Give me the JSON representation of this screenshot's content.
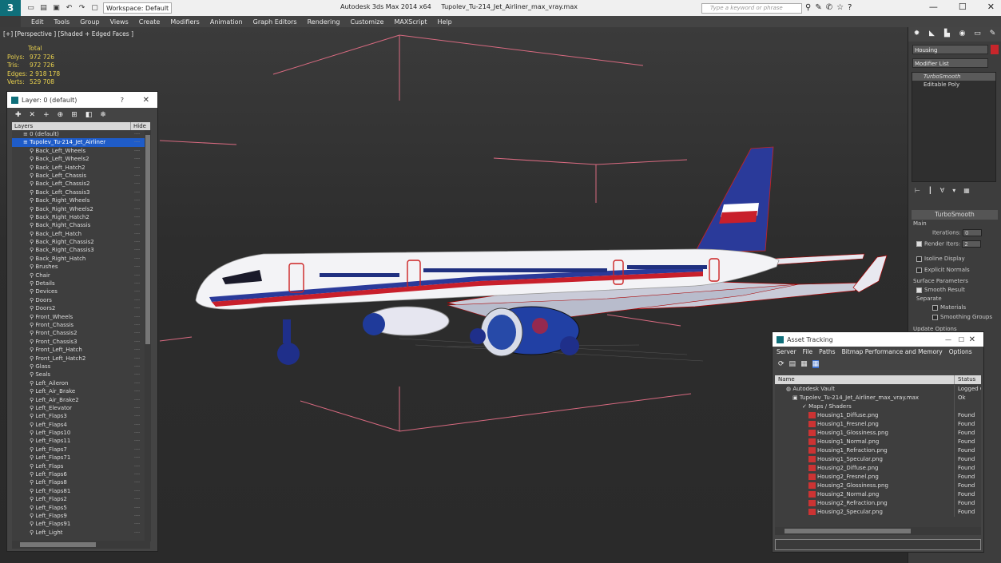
{
  "titlebar": {
    "logo": "3",
    "workspace": "Workspace: Default",
    "app": "Autodesk 3ds Max 2014 x64",
    "file": "Tupolev_Tu-214_Jet_Airliner_max_vray.max",
    "search_placeholder": "Type a keyword or phrase"
  },
  "menu": [
    "Edit",
    "Tools",
    "Group",
    "Views",
    "Create",
    "Modifiers",
    "Animation",
    "Graph Editors",
    "Rendering",
    "Customize",
    "MAXScript",
    "Help"
  ],
  "viewport": {
    "label": "[+] [Perspective ] [Shaded + Edged Faces ]",
    "stats": {
      "header": "Total",
      "polys_label": "Polys:",
      "polys": "972 726",
      "tris_label": "Tris:",
      "tris": "972 726",
      "edges_label": "Edges:",
      "edges": "2 918 178",
      "verts_label": "Verts:",
      "verts": "529 708"
    }
  },
  "layer_panel": {
    "title": "Layer: 0 (default)",
    "help": "?",
    "col_layers": "Layers",
    "col_hide": "Hide",
    "root": "0 (default)",
    "selected": "Tupolev_Tu-214_Jet_Airliner",
    "items": [
      "Back_Left_Wheels",
      "Back_Left_Wheels2",
      "Back_Left_Hatch2",
      "Back_Left_Chassis",
      "Back_Left_Chassis2",
      "Back_Left_Chassis3",
      "Back_Right_Wheels",
      "Back_Right_Wheels2",
      "Back_Right_Hatch2",
      "Back_Right_Chassis",
      "Back_Left_Hatch",
      "Back_Right_Chassis2",
      "Back_Right_Chassis3",
      "Back_Right_Hatch",
      "Brushes",
      "Chair",
      "Details",
      "Devices",
      "Doors",
      "Doors2",
      "Front_Wheels",
      "Front_Chassis",
      "Front_Chassis2",
      "Front_Chassis3",
      "Front_Left_Hatch",
      "Front_Left_Hatch2",
      "Glass",
      "Seals",
      "Left_Aileron",
      "Left_Air_Brake",
      "Left_Air_Brake2",
      "Left_Elevator",
      "Left_Flaps3",
      "Left_Flaps4",
      "Left_Flaps10",
      "Left_Flaps11",
      "Left_Flaps7",
      "Left_Flaps71",
      "Left_Flaps",
      "Left_Flaps6",
      "Left_Flaps8",
      "Left_Flaps81",
      "Left_Flaps2",
      "Left_Flaps5",
      "Left_Flaps9",
      "Left_Flaps91",
      "Left_Light"
    ]
  },
  "right_panel": {
    "object_name": "Housing",
    "modifier_list": "Modifier List",
    "stack": [
      "TurboSmooth",
      "Editable Poly"
    ],
    "rollout": "TurboSmooth",
    "main_label": "Main",
    "iterations_label": "Iterations:",
    "iterations": "0",
    "render_iters_label": "Render Iters:",
    "render_iters": "2",
    "isoline": "Isoline Display",
    "explicit": "Explicit Normals",
    "surface": "Surface Parameters",
    "smooth_result": "Smooth Result",
    "separate": "Separate",
    "materials": "Materials",
    "smoothing": "Smoothing Groups",
    "update": "Update Options"
  },
  "asset_tracking": {
    "title": "Asset Tracking",
    "menu": [
      "Server",
      "File",
      "Paths",
      "Bitmap Performance and Memory",
      "Options"
    ],
    "col_name": "Name",
    "col_status": "Status",
    "vault": "Autodesk Vault",
    "vault_status": "Logged O",
    "file": "Tupolev_Tu-214_Jet_Airliner_max_vray.max",
    "file_status": "Ok",
    "maps": "Maps / Shaders",
    "rows": [
      {
        "name": "Housing1_Diffuse.png",
        "status": "Found"
      },
      {
        "name": "Housing1_Fresnel.png",
        "status": "Found"
      },
      {
        "name": "Housing1_Glossiness.png",
        "status": "Found"
      },
      {
        "name": "Housing1_Normal.png",
        "status": "Found"
      },
      {
        "name": "Housing1_Refraction.png",
        "status": "Found"
      },
      {
        "name": "Housing1_Specular.png",
        "status": "Found"
      },
      {
        "name": "Housing2_Diffuse.png",
        "status": "Found"
      },
      {
        "name": "Housing2_Fresnel.png",
        "status": "Found"
      },
      {
        "name": "Housing2_Glossiness.png",
        "status": "Found"
      },
      {
        "name": "Housing2_Normal.png",
        "status": "Found"
      },
      {
        "name": "Housing2_Refraction.png",
        "status": "Found"
      },
      {
        "name": "Housing2_Specular.png",
        "status": "Found"
      }
    ]
  }
}
